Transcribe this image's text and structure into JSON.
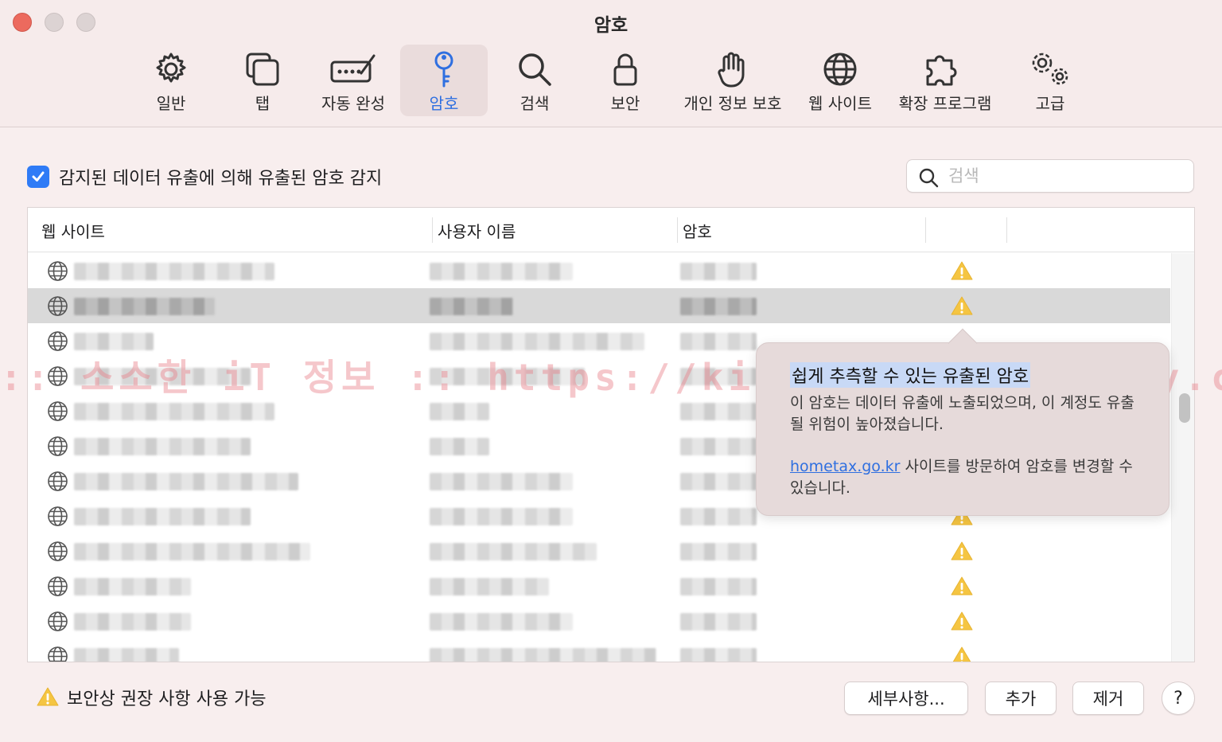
{
  "window": {
    "title": "암호"
  },
  "toolbar": {
    "tabs": [
      {
        "label": "일반",
        "icon": "gear-icon"
      },
      {
        "label": "탭",
        "icon": "tabs-icon"
      },
      {
        "label": "자동 완성",
        "icon": "autofill-icon"
      },
      {
        "label": "암호",
        "icon": "key-icon",
        "active": true
      },
      {
        "label": "검색",
        "icon": "magnifier-icon"
      },
      {
        "label": "보안",
        "icon": "lock-icon"
      },
      {
        "label": "개인 정보 보호",
        "icon": "hand-icon"
      },
      {
        "label": "웹 사이트",
        "icon": "globe-icon"
      },
      {
        "label": "확장 프로그램",
        "icon": "puzzle-icon"
      },
      {
        "label": "고급",
        "icon": "gears-icon"
      }
    ]
  },
  "options": {
    "detect_label": "감지된 데이터 유출에 의해 유출된 암호 감지",
    "detect_checked": true
  },
  "search": {
    "placeholder": "검색"
  },
  "table": {
    "columns": [
      "웹 사이트",
      "사용자 이름",
      "암호"
    ]
  },
  "popover": {
    "title": "쉽게 추측할 수 있는 유출된 암호",
    "body": "이 암호는 데이터 유출에 노출되었으며, 이 계정도 유출될 위험이 높아졌습니다.",
    "link_text": "hometax.go.kr",
    "link_suffix": " 사이트를 방문하여 암호를 변경할 수 있습니다."
  },
  "watermark": ":: 소소한 iT 정보 :: https://kimsungjin.tistory.com ::",
  "footer": {
    "security_note": "보안상 권장 사항 사용 가능",
    "details_button": "세부사항...",
    "add_button": "추가",
    "remove_button": "제거",
    "help_button": "?"
  },
  "colors": {
    "accent": "#2f7bf6",
    "warning": "#f5c542",
    "link": "#2f6fe0"
  }
}
